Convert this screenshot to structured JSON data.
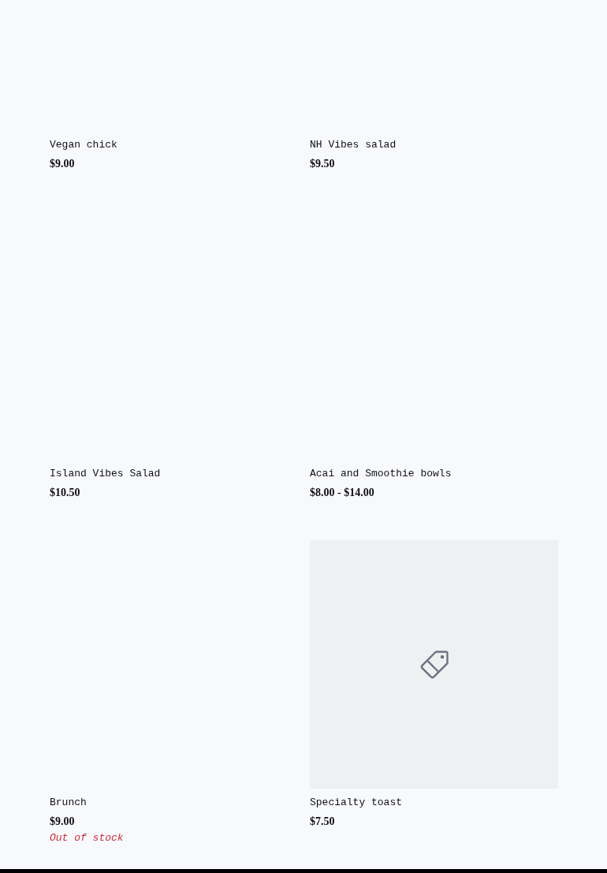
{
  "products": [
    {
      "name": "Vegan chick",
      "price": "$9.00",
      "kind": "none"
    },
    {
      "name": "NH Vibes salad",
      "price": "$9.50",
      "kind": "none"
    },
    {
      "name": "Island Vibes Salad",
      "price": "$10.50",
      "kind": "none"
    },
    {
      "name": "Acai and Smoothie bowls",
      "price": "$8.00 - $14.00",
      "kind": "none"
    },
    {
      "name": "Brunch",
      "price": "$9.00",
      "kind": "none",
      "stock_note": "Out of stock"
    },
    {
      "name": "Specialty toast",
      "price": "$7.50",
      "kind": "placeholder"
    }
  ]
}
